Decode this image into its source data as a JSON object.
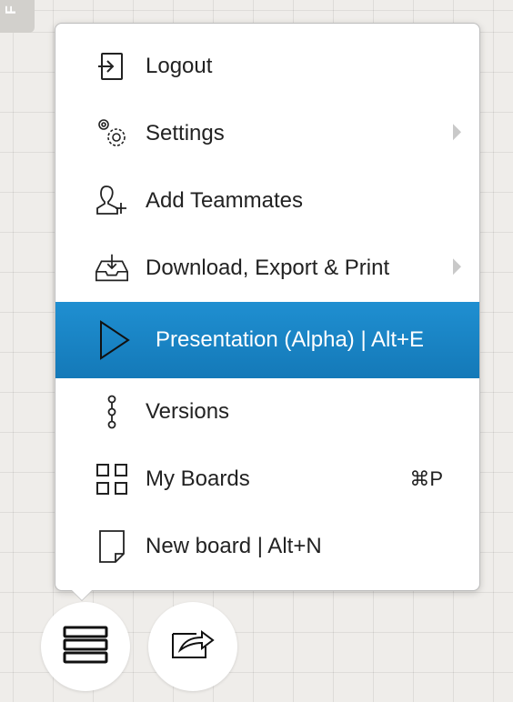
{
  "corner_tab": {
    "label": "F"
  },
  "menu": {
    "items": [
      {
        "label": "Logout",
        "icon": "logout-icon",
        "has_submenu": false,
        "shortcut": ""
      },
      {
        "label": "Settings",
        "icon": "gears-icon",
        "has_submenu": true,
        "shortcut": ""
      },
      {
        "label": "Add Teammates",
        "icon": "add-user-icon",
        "has_submenu": false,
        "shortcut": ""
      },
      {
        "label": "Download, Export & Print",
        "icon": "tray-download-icon",
        "has_submenu": true,
        "shortcut": ""
      },
      {
        "label": "Presentation (Alpha) | Alt+E",
        "icon": "play-icon",
        "has_submenu": false,
        "shortcut": "",
        "active": true
      },
      {
        "label": "Versions",
        "icon": "versions-icon",
        "has_submenu": false,
        "shortcut": ""
      },
      {
        "label": "My Boards",
        "icon": "grid-icon",
        "has_submenu": false,
        "shortcut": "⌘P"
      },
      {
        "label": "New board | Alt+N",
        "icon": "page-icon",
        "has_submenu": false,
        "shortcut": ""
      }
    ]
  },
  "bottom_buttons": [
    {
      "icon": "menu-stack-icon"
    },
    {
      "icon": "share-export-icon"
    }
  ],
  "colors": {
    "active_bg": "#1a86c8",
    "canvas_bg": "#efedea"
  }
}
